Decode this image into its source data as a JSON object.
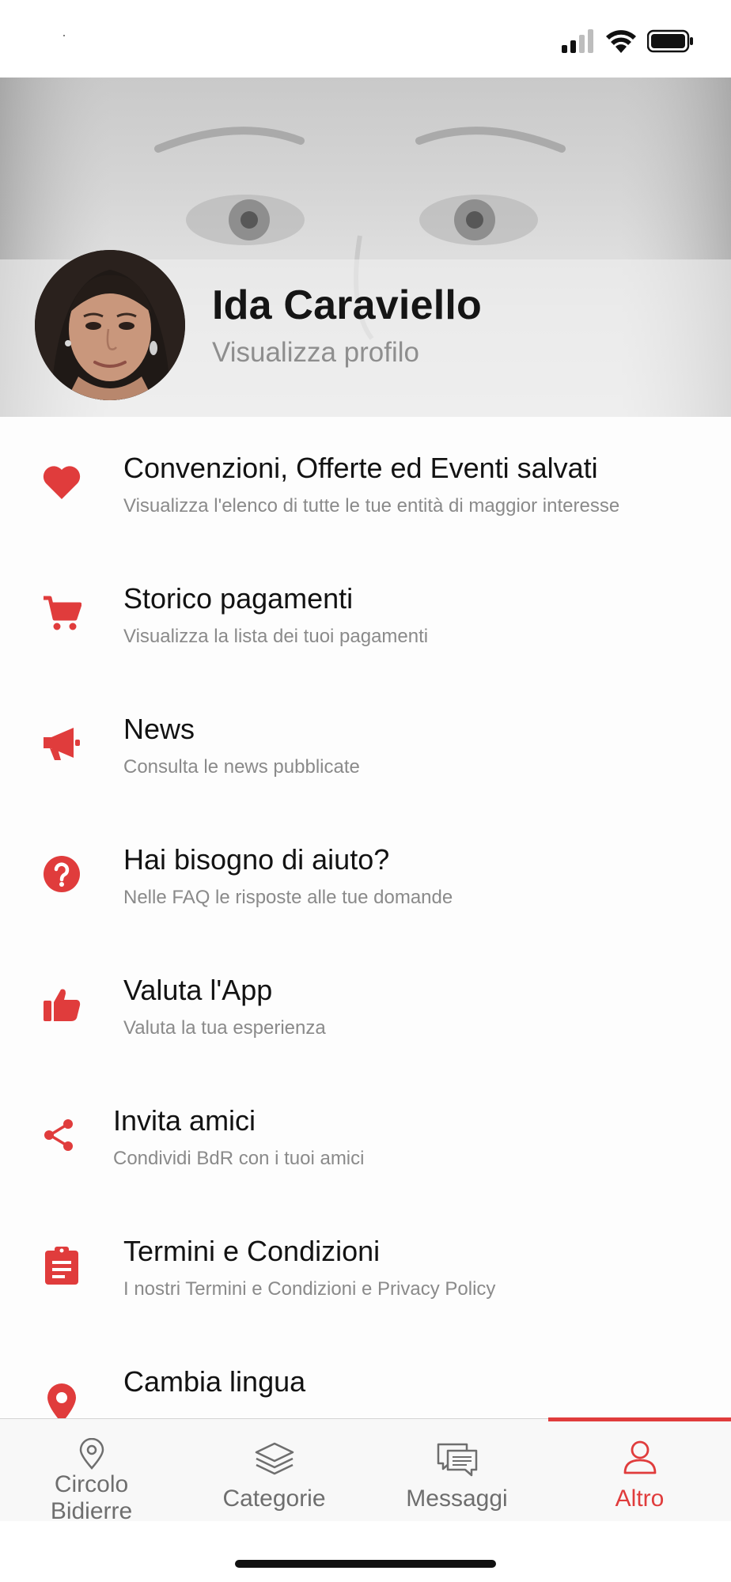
{
  "colors": {
    "accent": "#e03c3c",
    "tab_inactive": "#6e6e6e",
    "subtitle": "#8a8a8a"
  },
  "profile": {
    "name": "Ida Caraviello",
    "link": "Visualizza profilo"
  },
  "menu": [
    {
      "icon": "heart-icon",
      "title": "Convenzioni, Offerte ed Eventi salvati",
      "subtitle": "Visualizza l'elenco di tutte le tue entità di maggior interesse"
    },
    {
      "icon": "cart-icon",
      "title": "Storico pagamenti",
      "subtitle": "Visualizza la lista dei tuoi pagamenti"
    },
    {
      "icon": "megaphone-icon",
      "title": "News",
      "subtitle": "Consulta le news pubblicate"
    },
    {
      "icon": "help-icon",
      "title": "Hai bisogno di aiuto?",
      "subtitle": "Nelle FAQ le risposte alle tue domande"
    },
    {
      "icon": "thumbs-up-icon",
      "title": "Valuta l'App",
      "subtitle": "Valuta la tua esperienza"
    },
    {
      "icon": "share-icon",
      "title": "Invita amici",
      "subtitle": "Condividi BdR con i tuoi amici"
    },
    {
      "icon": "clipboard-icon",
      "title": "Termini e Condizioni",
      "subtitle": "I nostri Termini e Condizioni e Privacy Policy"
    },
    {
      "icon": "location-pin-icon",
      "title": "Cambia lingua",
      "subtitle": ""
    }
  ],
  "tabs": [
    {
      "icon": "map-pin-icon",
      "label_line1": "Circolo",
      "label_line2": "Bidierre",
      "active": false
    },
    {
      "icon": "layers-icon",
      "label": "Categorie",
      "active": false
    },
    {
      "icon": "chat-icon",
      "label": "Messaggi",
      "active": false
    },
    {
      "icon": "user-icon",
      "label": "Altro",
      "active": true
    }
  ]
}
